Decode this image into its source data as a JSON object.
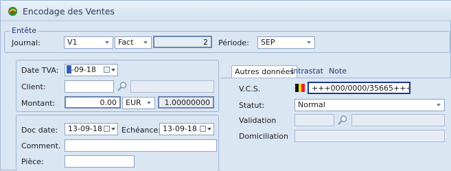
{
  "window": {
    "title": "Encodage des Ventes"
  },
  "entete": {
    "legend": "Entête",
    "journal_label": "Journal:",
    "journal_value": "V1",
    "type_value": "Fact",
    "number_value": "2",
    "periode_label": "Période:",
    "periode_value": "SEP"
  },
  "left_group1": {
    "date_tva_label": "Date TVA:",
    "date_tva_value": "-09-18",
    "client_label": "Client:",
    "client_value": "",
    "client_name": "",
    "montant_label": "Montant:",
    "montant_value": "0.00",
    "currency_value": "EUR",
    "rate_value": "1.00000000"
  },
  "left_group2": {
    "doc_date_label": "Doc date:",
    "doc_date_value": "13-09-18",
    "echeance_label": "Echéance:",
    "echeance_value": "13-09-18",
    "comment_label": "Comment.",
    "comment_value": "",
    "piece_label": "Pièce:",
    "piece_value": ""
  },
  "tabs": [
    {
      "label": "Autres données"
    },
    {
      "label": "Intrastat"
    },
    {
      "label": "Note"
    }
  ],
  "autres": {
    "vcs_label": "V.C.S.",
    "vcs_value": "+++000/0000/35665+++",
    "statut_label": "Statut:",
    "statut_value": "Normal",
    "validation_label": "Validation",
    "domiciliation_label": "Domiciliation"
  },
  "colors": {
    "background": "#dbe6f3",
    "border": "#9db4d4",
    "legend_text": "#1e3a6e",
    "vcs_border": "#1a3a8a"
  },
  "icons": {
    "app": "app-logo-icon",
    "search": "search-icon",
    "calendar": "calendar-icon",
    "flag": "belgium-flag-icon"
  }
}
